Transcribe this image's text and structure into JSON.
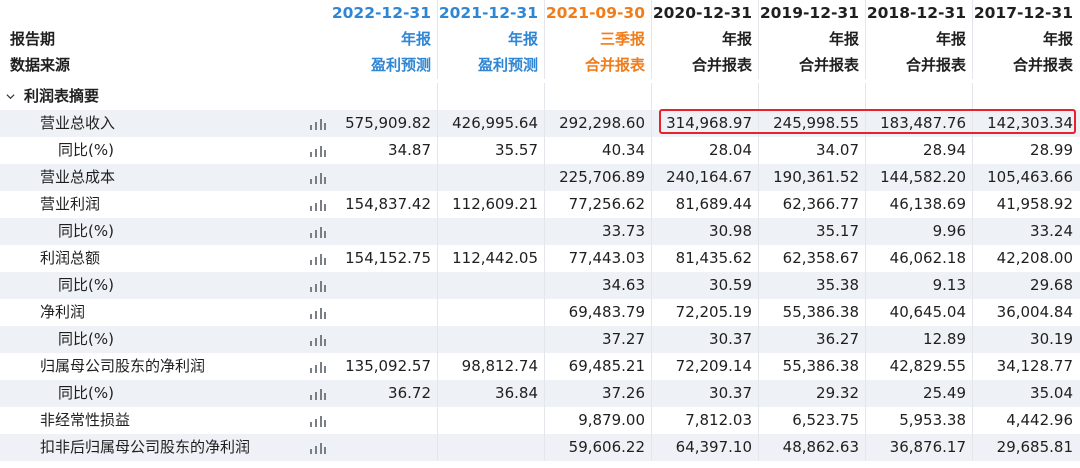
{
  "header": {
    "periods": [
      {
        "date": "2022-12-31",
        "type": "年报",
        "source": "盈利预测",
        "color": "#2e86d4"
      },
      {
        "date": "2021-12-31",
        "type": "年报",
        "source": "盈利预测",
        "color": "#2e86d4"
      },
      {
        "date": "2021-09-30",
        "type": "三季报",
        "source": "合并报表",
        "color": "#f07c1a"
      },
      {
        "date": "2020-12-31",
        "type": "年报",
        "source": "合并报表",
        "color": "#1f1f1f"
      },
      {
        "date": "2019-12-31",
        "type": "年报",
        "source": "合并报表",
        "color": "#1f1f1f"
      },
      {
        "date": "2018-12-31",
        "type": "年报",
        "source": "合并报表",
        "color": "#1f1f1f"
      },
      {
        "date": "2017-12-31",
        "type": "年报",
        "source": "合并报表",
        "color": "#1f1f1f"
      }
    ],
    "report_period_label": "报告期",
    "data_source_label": "数据来源"
  },
  "section": {
    "title": "利润表摘要",
    "icon": "chevron-down-icon"
  },
  "rows": [
    {
      "label": "营业总收入",
      "indent": "mid",
      "values": [
        "575,909.82",
        "426,995.64",
        "292,298.60",
        "314,968.97",
        "245,998.55",
        "183,487.76",
        "142,303.34"
      ]
    },
    {
      "label": "同比(%)",
      "indent": "sub",
      "values": [
        "34.87",
        "35.57",
        "40.34",
        "28.04",
        "34.07",
        "28.94",
        "28.99"
      ]
    },
    {
      "label": "营业总成本",
      "indent": "mid",
      "values": [
        "",
        "",
        "225,706.89",
        "240,164.67",
        "190,361.52",
        "144,582.20",
        "105,463.66"
      ]
    },
    {
      "label": "营业利润",
      "indent": "mid",
      "values": [
        "154,837.42",
        "112,609.21",
        "77,256.62",
        "81,689.44",
        "62,366.77",
        "46,138.69",
        "41,958.92"
      ]
    },
    {
      "label": "同比(%)",
      "indent": "sub",
      "values": [
        "",
        "",
        "33.73",
        "30.98",
        "35.17",
        "9.96",
        "33.24"
      ]
    },
    {
      "label": "利润总额",
      "indent": "mid",
      "values": [
        "154,152.75",
        "112,442.05",
        "77,443.03",
        "81,435.62",
        "62,358.67",
        "46,062.18",
        "42,208.00"
      ]
    },
    {
      "label": "同比(%)",
      "indent": "sub",
      "values": [
        "",
        "",
        "34.63",
        "30.59",
        "35.38",
        "9.13",
        "29.68"
      ]
    },
    {
      "label": "净利润",
      "indent": "mid",
      "values": [
        "",
        "",
        "69,483.79",
        "72,205.19",
        "55,386.38",
        "40,645.04",
        "36,004.84"
      ]
    },
    {
      "label": "同比(%)",
      "indent": "sub",
      "values": [
        "",
        "",
        "37.27",
        "30.37",
        "36.27",
        "12.89",
        "30.19"
      ]
    },
    {
      "label": "归属母公司股东的净利润",
      "indent": "mid",
      "values": [
        "135,092.57",
        "98,812.74",
        "69,485.21",
        "72,209.14",
        "55,386.38",
        "42,829.55",
        "34,128.77"
      ]
    },
    {
      "label": "同比(%)",
      "indent": "sub",
      "values": [
        "36.72",
        "36.84",
        "37.26",
        "30.37",
        "29.32",
        "25.49",
        "35.04"
      ]
    },
    {
      "label": "非经常性损益",
      "indent": "mid",
      "values": [
        "",
        "",
        "9,879.00",
        "7,812.03",
        "6,523.75",
        "5,953.38",
        "4,442.96"
      ]
    },
    {
      "label": "扣非后归属母公司股东的净利润",
      "indent": "mid",
      "values": [
        "",
        "",
        "59,606.22",
        "64,397.10",
        "48,862.63",
        "36,876.17",
        "29,685.81"
      ]
    }
  ],
  "highlight": {
    "row_index": 0,
    "from_col": 3,
    "to_col": 6,
    "color": "#e8212c"
  },
  "colors": {
    "shade": "#eef1f6",
    "blue": "#2e86d4",
    "orange": "#f07c1a",
    "red_box": "#e8212c"
  }
}
